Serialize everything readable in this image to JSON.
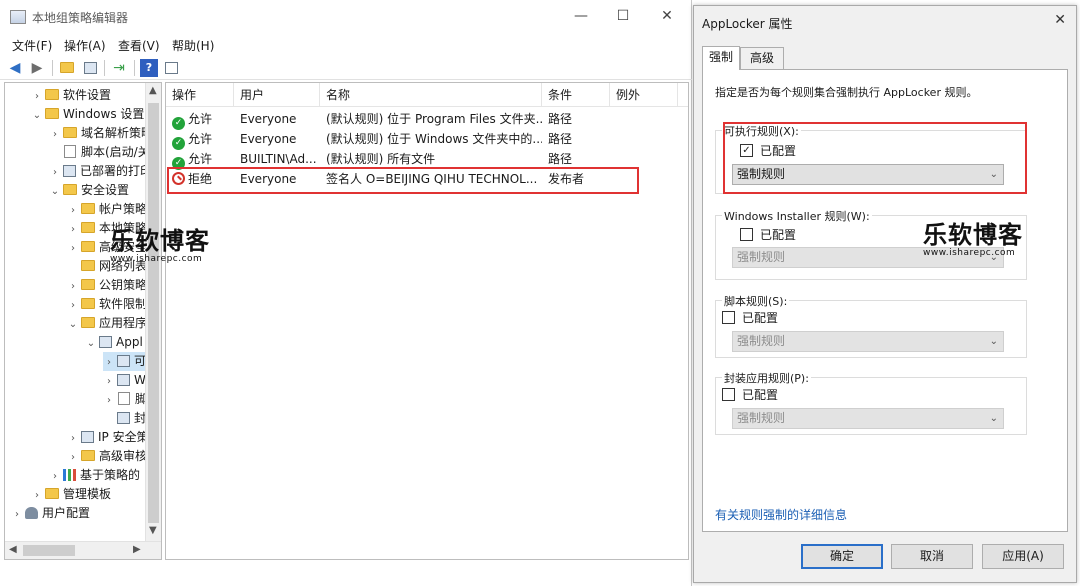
{
  "window": {
    "title": "本地组策略编辑器",
    "controls": {
      "minimize": "—",
      "maximize": "☐",
      "close": "✕"
    }
  },
  "menu": [
    "文件(F)",
    "操作(A)",
    "查看(V)",
    "帮助(H)"
  ],
  "tree": {
    "items": [
      "软件设置",
      "Windows 设置",
      "域名解析策略",
      "脚本(启动/关",
      "已部署的打印",
      "安全设置",
      "帐户策略",
      "本地策略",
      "高级安全",
      "网络列表",
      "公钥策略",
      "软件限制",
      "应用程序",
      "Appl",
      "可",
      "W",
      "脚",
      "封",
      "IP 安全策",
      "高级审核",
      "基于策略的",
      "管理模板",
      "用户配置"
    ]
  },
  "list": {
    "columns": [
      "操作",
      "用户",
      "名称",
      "条件",
      "例外"
    ],
    "rows": [
      {
        "action": "允许",
        "user": "Everyone",
        "name": "(默认规则) 位于 Program Files 文件夹...",
        "condition": "路径",
        "status": "allow"
      },
      {
        "action": "允许",
        "user": "Everyone",
        "name": "(默认规则) 位于 Windows 文件夹中的...",
        "condition": "路径",
        "status": "allow"
      },
      {
        "action": "允许",
        "user": "BUILTIN\\Ad...",
        "name": "(默认规则) 所有文件",
        "condition": "路径",
        "status": "allow"
      },
      {
        "action": "拒绝",
        "user": "Everyone",
        "name": "签名人 O=BEIJING QIHU TECHNOL...",
        "condition": "发布者",
        "status": "deny"
      }
    ]
  },
  "dialog": {
    "title": "AppLocker 属性",
    "tabs": [
      "强制",
      "高级"
    ],
    "intro": "指定是否为每个规则集合强制执行 AppLocker 规则。",
    "groups": [
      {
        "label": "可执行规则(X):",
        "checkbox_label": "已配置",
        "checked": true,
        "combo_value": "强制规则",
        "enabled": true
      },
      {
        "label": "Windows Installer 规则(W):",
        "checkbox_label": "已配置",
        "checked": false,
        "combo_value": "强制规则",
        "enabled": false
      },
      {
        "label": "脚本规则(S):",
        "checkbox_label": "已配置",
        "checked": false,
        "combo_value": "强制规则",
        "enabled": false
      },
      {
        "label": "封装应用规则(P):",
        "checkbox_label": "已配置",
        "checked": false,
        "combo_value": "强制规则",
        "enabled": false
      }
    ],
    "link": "有关规则强制的详细信息",
    "buttons": {
      "ok": "确定",
      "cancel": "取消",
      "apply": "应用(A)"
    },
    "close": "✕"
  },
  "watermark": {
    "main": "乐软博客",
    "sub": "www.isharepc.com"
  },
  "colors": {
    "highlight": "#e03232",
    "link": "#1b5fb4",
    "allow": "#22a33a",
    "deny": "#d3332b"
  }
}
